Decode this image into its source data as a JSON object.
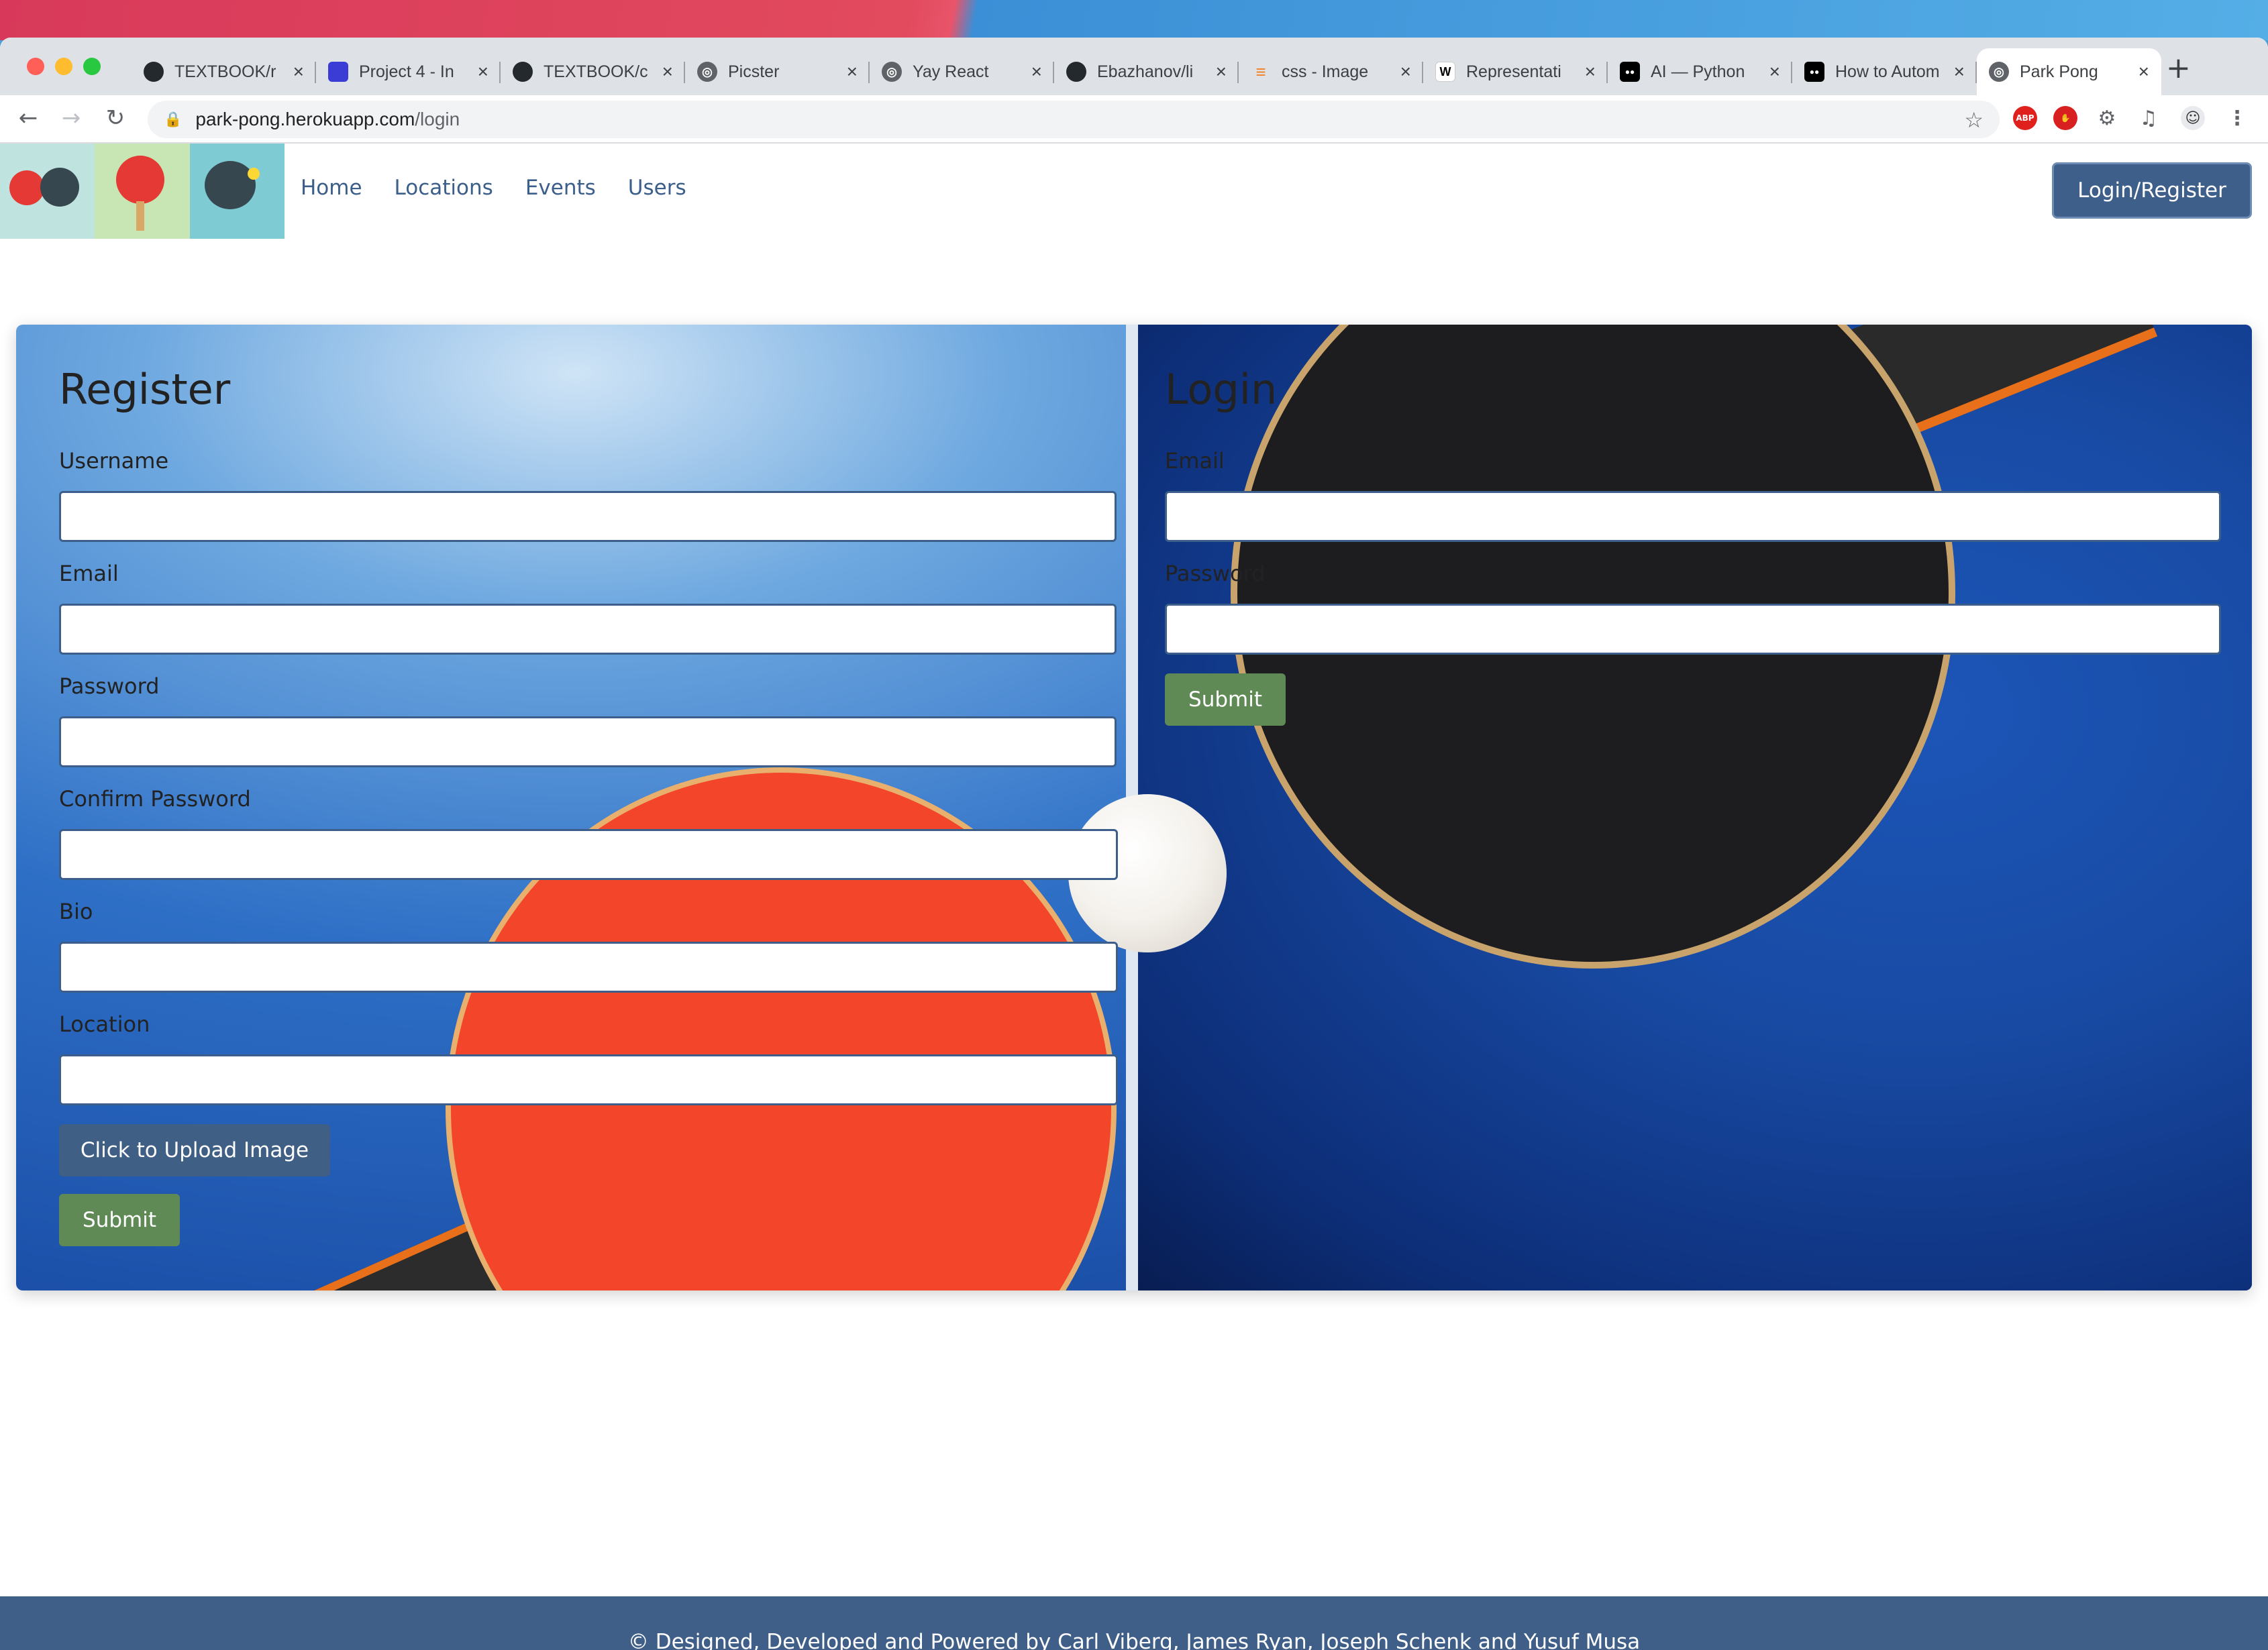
{
  "browser": {
    "tabs": [
      {
        "title": "TEXTBOOK/r",
        "icon": "github-icon",
        "color": "#24292e"
      },
      {
        "title": "Project 4 - In",
        "icon": "project-icon",
        "color": "#3b3bd6"
      },
      {
        "title": "TEXTBOOK/c",
        "icon": "github-icon",
        "color": "#24292e"
      },
      {
        "title": "Picster",
        "icon": "globe-icon",
        "color": "#5f6368"
      },
      {
        "title": "Yay React",
        "icon": "globe-icon",
        "color": "#5f6368"
      },
      {
        "title": "Ebazhanov/li",
        "icon": "github-icon",
        "color": "#24292e"
      },
      {
        "title": "css - Image",
        "icon": "stackoverflow-icon",
        "color": "#f48024"
      },
      {
        "title": "Representati",
        "icon": "wikipedia-icon",
        "color": "#ffffff"
      },
      {
        "title": "AI — Python",
        "icon": "medium-icon",
        "color": "#000000"
      },
      {
        "title": "How to Autom",
        "icon": "medium-icon",
        "color": "#000000"
      },
      {
        "title": "Park Pong",
        "icon": "globe-icon",
        "color": "#5f6368",
        "active": true
      }
    ],
    "new_tab": "+",
    "url_host": "park-pong.herokuapp.com",
    "url_path": "/login"
  },
  "site": {
    "nav": {
      "home": "Home",
      "locations": "Locations",
      "events": "Events",
      "users": "Users",
      "login_register": "Login/Register"
    },
    "register": {
      "title": "Register",
      "username_label": "Username",
      "email_label": "Email",
      "password_label": "Password",
      "confirm_password_label": "Confirm Password",
      "bio_label": "Bio",
      "location_label": "Location",
      "upload_label": "Click to Upload Image",
      "submit_label": "Submit"
    },
    "login": {
      "title": "Login",
      "email_label": "Email",
      "password_label": "Password",
      "submit_label": "Submit"
    },
    "footer": "© Designed, Developed and Powered by Carl Viberg, James Ryan, Joseph Schenk and Yusuf Musa"
  },
  "colors": {
    "primary": "#3e5f8a",
    "submit_green": "#5f8a55",
    "upload_blue": "#3f5f85"
  }
}
